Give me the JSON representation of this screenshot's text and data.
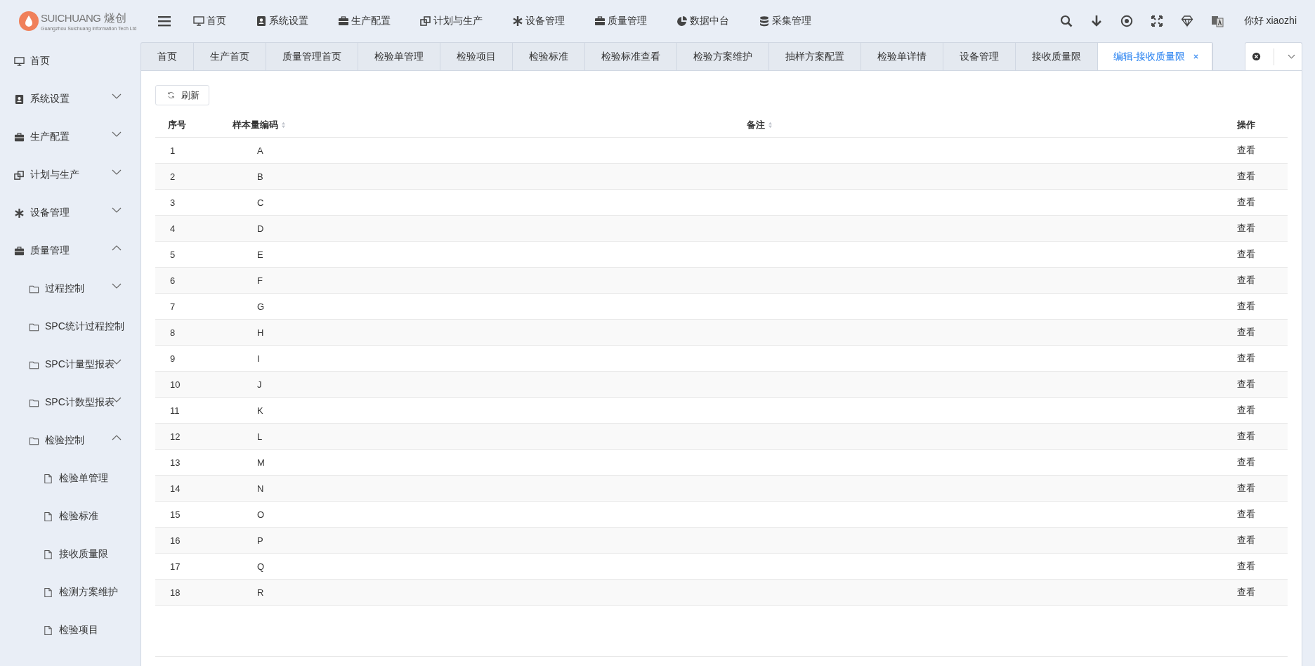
{
  "logo": {
    "brand": "SUICHUANG",
    "brand_cn": "燧创",
    "subtitle": "Guangzhou Suichuang Information Tech Ltd"
  },
  "top_nav": [
    {
      "label": "首页"
    },
    {
      "label": "系统设置"
    },
    {
      "label": "生产配置"
    },
    {
      "label": "计划与生产"
    },
    {
      "label": "设备管理"
    },
    {
      "label": "质量管理"
    },
    {
      "label": "数据中台"
    },
    {
      "label": "采集管理"
    }
  ],
  "user": {
    "greeting": "你好 xiaozhi"
  },
  "sidebar": {
    "items": [
      {
        "label": "首页"
      },
      {
        "label": "系统设置",
        "expanded": false
      },
      {
        "label": "生产配置",
        "expanded": false
      },
      {
        "label": "计划与生产",
        "expanded": false
      },
      {
        "label": "设备管理",
        "expanded": false
      },
      {
        "label": "质量管理",
        "expanded": true,
        "children": [
          {
            "label": "过程控制",
            "expanded": false
          },
          {
            "label": "SPC统计过程控制"
          },
          {
            "label": "SPC计量型报表",
            "expanded": false
          },
          {
            "label": "SPC计数型报表",
            "expanded": false
          },
          {
            "label": "检验控制",
            "expanded": true,
            "children": [
              {
                "label": "检验单管理"
              },
              {
                "label": "检验标准"
              },
              {
                "label": "接收质量限"
              },
              {
                "label": "检测方案维护"
              },
              {
                "label": "检验项目"
              }
            ]
          }
        ]
      }
    ]
  },
  "tabs": [
    {
      "label": "首页",
      "selected": false
    },
    {
      "label": "生产首页",
      "selected": false
    },
    {
      "label": "质量管理首页",
      "selected": false
    },
    {
      "label": "检验单管理",
      "selected": false
    },
    {
      "label": "检验项目",
      "selected": false
    },
    {
      "label": "检验标准",
      "selected": false
    },
    {
      "label": "检验标准查看",
      "selected": false
    },
    {
      "label": "检验方案维护",
      "selected": false
    },
    {
      "label": "抽样方案配置",
      "selected": false
    },
    {
      "label": "检验单详情",
      "selected": false
    },
    {
      "label": "设备管理",
      "selected": false
    },
    {
      "label": "接收质量限",
      "selected": false
    },
    {
      "label": "编辑-接收质量限",
      "selected": true
    }
  ],
  "toolbar": {
    "refresh": "刷新"
  },
  "table": {
    "columns": [
      {
        "label": "序号",
        "sortable": false
      },
      {
        "label": "样本量编码",
        "sortable": true
      },
      {
        "label": "备注",
        "sortable": true
      },
      {
        "label": "操作",
        "sortable": false
      }
    ],
    "rows": [
      {
        "index": "1",
        "code": "A",
        "action": "查看"
      },
      {
        "index": "2",
        "code": "B",
        "action": "查看"
      },
      {
        "index": "3",
        "code": "C",
        "action": "查看"
      },
      {
        "index": "4",
        "code": "D",
        "action": "查看"
      },
      {
        "index": "5",
        "code": "E",
        "action": "查看"
      },
      {
        "index": "6",
        "code": "F",
        "action": "查看"
      },
      {
        "index": "7",
        "code": "G",
        "action": "查看"
      },
      {
        "index": "8",
        "code": "H",
        "action": "查看"
      },
      {
        "index": "9",
        "code": "I",
        "action": "查看"
      },
      {
        "index": "10",
        "code": "J",
        "action": "查看"
      },
      {
        "index": "11",
        "code": "K",
        "action": "查看"
      },
      {
        "index": "12",
        "code": "L",
        "action": "查看"
      },
      {
        "index": "13",
        "code": "M",
        "action": "查看"
      },
      {
        "index": "14",
        "code": "N",
        "action": "查看"
      },
      {
        "index": "15",
        "code": "O",
        "action": "查看"
      },
      {
        "index": "16",
        "code": "P",
        "action": "查看"
      },
      {
        "index": "17",
        "code": "Q",
        "action": "查看"
      },
      {
        "index": "18",
        "code": "R",
        "action": "查看"
      }
    ]
  }
}
